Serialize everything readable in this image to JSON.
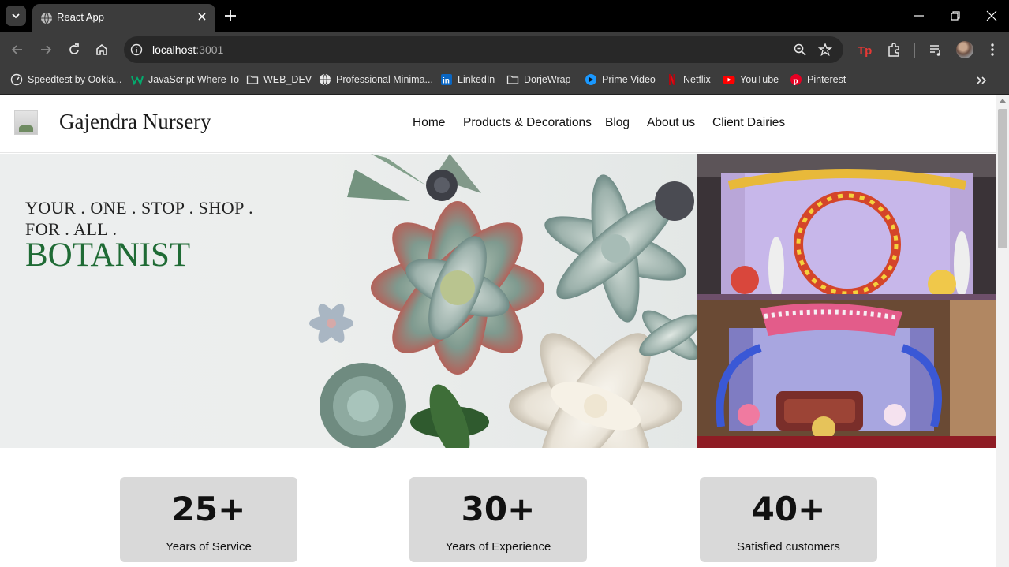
{
  "browser": {
    "tab_title": "React App",
    "url_host": "localhost",
    "url_port": ":3001",
    "bookmarks": [
      {
        "label": "Speedtest by Ookla...",
        "icon": "speedtest-icon"
      },
      {
        "label": "JavaScript Where To",
        "icon": "w3schools-icon"
      },
      {
        "label": "WEB_DEV",
        "icon": "folder-icon"
      },
      {
        "label": "Professional Minima...",
        "icon": "globe-icon"
      },
      {
        "label": "LinkedIn",
        "icon": "linkedin-icon"
      },
      {
        "label": "DorjeWrap",
        "icon": "folder-icon"
      },
      {
        "label": "Prime Video",
        "icon": "prime-video-icon"
      },
      {
        "label": "Netflix",
        "icon": "netflix-icon"
      },
      {
        "label": "YouTube",
        "icon": "youtube-icon"
      },
      {
        "label": "Pinterest",
        "icon": "pinterest-icon"
      }
    ]
  },
  "site": {
    "brand": "Gajendra Nursery",
    "nav": [
      "Home",
      "Products & Decorations",
      "Blog",
      "About us",
      "Client Dairies"
    ]
  },
  "hero": {
    "tagline_line1": "YOUR . ONE . STOP . SHOP .",
    "tagline_line2": "FOR . ALL .",
    "tagline_main": "BOTANIST"
  },
  "stats": [
    {
      "value": "25+",
      "label": "Years of Service"
    },
    {
      "value": "30+",
      "label": "Years of Experience"
    },
    {
      "value": "40+",
      "label": "Satisfied customers"
    }
  ],
  "colors": {
    "accent_green": "#1f6b35",
    "card_bg": "#d9d9d9",
    "chrome_dark": "#3c3c3c"
  }
}
